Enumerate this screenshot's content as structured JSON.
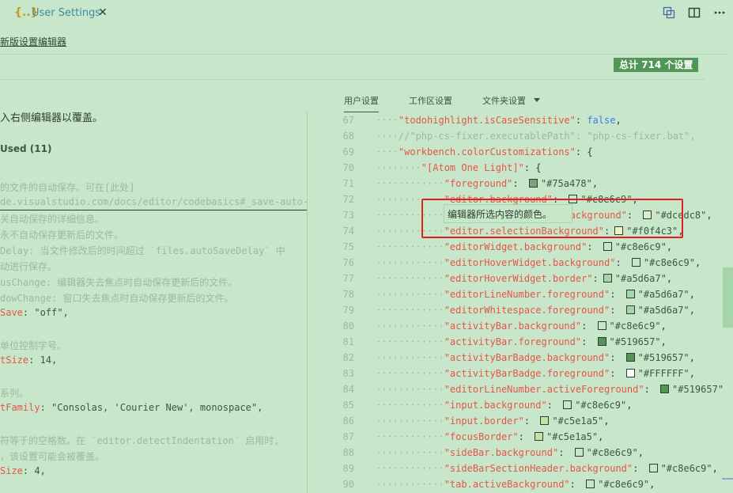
{
  "tab": {
    "title": "User Settings",
    "close": "✕",
    "braces": "{..}"
  },
  "link": "新版设置编辑器",
  "count_badge": "总计 714 个设置",
  "left_lines": [
    {
      "text": "入右侧编辑器以覆盖。",
      "kind": "txt"
    },
    {
      "text": "Used (11)",
      "kind": "hdr"
    },
    {
      "text": "的文件的自动保存。可在[此处]",
      "kind": "cmt"
    },
    {
      "text": "de.visualstudio.com/docs/editor/codebasics#_save-auto-s",
      "kind": "cmt"
    },
    {
      "text": "关自动保存的详细信息。",
      "kind": "cmt"
    },
    {
      "text": "永不自动保存更新后的文件。",
      "kind": "cmt"
    },
    {
      "text": "Delay: 当文件修改后的时间超过 `files.autoSaveDelay` 中",
      "kind": "cmt"
    },
    {
      "text": "动进行保存。",
      "kind": "cmt"
    },
    {
      "text": "usChange: 编辑器失去焦点时自动保存更新后的文件。",
      "kind": "cmt"
    },
    {
      "text": "dowChange: 窗口失去焦点时自动保存更新后的文件。",
      "kind": "cmt"
    },
    {
      "key": "Save",
      "rest": ": \"off\","
    },
    {
      "text": "单位控制字号。",
      "kind": "cmt"
    },
    {
      "key": "tSize",
      "rest": ": 14,"
    },
    {
      "text": "系列。",
      "kind": "cmt"
    },
    {
      "key": "tFamily",
      "rest": ": \"Consolas, 'Courier New', monospace\","
    },
    {
      "text": "符等于的空格数。在 `editor.detectIndentation` 启用时,",
      "kind": "cmt"
    },
    {
      "text": "，该设置可能会被覆盖。",
      "kind": "cmt"
    },
    {
      "key": "Size",
      "rest": ": 4,"
    }
  ],
  "scope_tabs": [
    "用户设置",
    "工作区设置",
    "文件夹设置"
  ],
  "code": [
    {
      "n": "67",
      "indent": 1,
      "key": "\"todohighlight.isCaseSensitive\"",
      "rest": ": ",
      "val": "false",
      "valtype": "b",
      "tail": ","
    },
    {
      "n": "68",
      "indent": 1,
      "comment": "//\"php-cs-fixer.executablePath\": \"php-cs-fixer.bat\","
    },
    {
      "n": "69",
      "indent": 1,
      "key": "\"workbench.colorCustomizations\"",
      "rest": ": {"
    },
    {
      "n": "70",
      "indent": 2,
      "key": "\"[Atom One Light]\"",
      "rest": ": {"
    },
    {
      "n": "71",
      "indent": 3,
      "key": "\"foreground\"",
      "rest": ": ",
      "swatch": "#75a478",
      "val": "\"#75a478\"",
      "tail": ","
    },
    {
      "n": "72",
      "indent": 3,
      "key": "\"editor.background\"",
      "rest": ": ",
      "swatch": "#c8e6c9",
      "val": "\"#c8e6c9\"",
      "tail": ","
    },
    {
      "n": "73",
      "indent": 3,
      "key": "\"editor.lineHighlightBackground\"",
      "rest": ": ",
      "swatch": "#dcedc8",
      "val": "\"#dcedc8\"",
      "tail": ","
    },
    {
      "n": "74",
      "indent": 3,
      "key": "\"editor.selectionBackground\"",
      "rest": ":",
      "swatch": "#f0f4c3",
      "val": "\"#f0f4c3\"",
      "tail": ","
    },
    {
      "n": "75",
      "indent": 3,
      "key": "\"editorWidget.background\"",
      "rest": ": ",
      "swatch": "#c8e6c9",
      "val": "\"#c8e6c9\"",
      "tail": ","
    },
    {
      "n": "76",
      "indent": 3,
      "key": "\"editorHoverWidget.background\"",
      "rest": ": ",
      "swatch": "#c8e6c9",
      "val": "\"#c8e6c9\"",
      "tail": ","
    },
    {
      "n": "77",
      "indent": 3,
      "key": "\"editorHoverWidget.border\"",
      "rest": ":",
      "swatch": "#a5d6a7",
      "val": "\"#a5d6a7\"",
      "tail": ","
    },
    {
      "n": "78",
      "indent": 3,
      "key": "\"editorLineNumber.foreground\"",
      "rest": ": ",
      "swatch": "#a5d6a7",
      "val": "\"#a5d6a7\"",
      "tail": ","
    },
    {
      "n": "79",
      "indent": 3,
      "key": "\"editorWhitespace.foreground\"",
      "rest": ": ",
      "swatch": "#a5d6a7",
      "val": "\"#a5d6a7\"",
      "tail": ","
    },
    {
      "n": "80",
      "indent": 3,
      "key": "\"activityBar.background\"",
      "rest": ": ",
      "swatch": "#c8e6c9",
      "val": "\"#c8e6c9\"",
      "tail": ","
    },
    {
      "n": "81",
      "indent": 3,
      "key": "\"activityBar.foreground\"",
      "rest": ": ",
      "swatch": "#519657",
      "val": "\"#519657\"",
      "tail": ","
    },
    {
      "n": "82",
      "indent": 3,
      "key": "\"activityBarBadge.background\"",
      "rest": ": ",
      "swatch": "#519657",
      "val": "\"#519657\"",
      "tail": ","
    },
    {
      "n": "83",
      "indent": 3,
      "key": "\"activityBarBadge.foreground\"",
      "rest": ": ",
      "swatch": "#FFFFFF",
      "val": "\"#FFFFFF\"",
      "tail": ","
    },
    {
      "n": "84",
      "indent": 3,
      "key": "\"editorLineNumber.activeForeground\"",
      "rest": ": ",
      "swatch": "#519657",
      "val": "\"#519657\"",
      "tail": ","
    },
    {
      "n": "85",
      "indent": 3,
      "key": "\"input.background\"",
      "rest": ": ",
      "swatch": "#c8e6c9",
      "val": "\"#c8e6c9\"",
      "tail": ","
    },
    {
      "n": "86",
      "indent": 3,
      "key": "\"input.border\"",
      "rest": ": ",
      "swatch": "#c5e1a5",
      "val": "\"#c5e1a5\"",
      "tail": ","
    },
    {
      "n": "87",
      "indent": 3,
      "key": "\"focusBorder\"",
      "rest": ": ",
      "swatch": "#c5e1a5",
      "val": "\"#c5e1a5\"",
      "tail": ","
    },
    {
      "n": "88",
      "indent": 3,
      "key": "\"sideBar.background\"",
      "rest": ": ",
      "swatch": "#c8e6c9",
      "val": "\"#c8e6c9\"",
      "tail": ","
    },
    {
      "n": "89",
      "indent": 3,
      "key": "\"sideBarSectionHeader.background\"",
      "rest": ": ",
      "swatch": "#c8e6c9",
      "val": "\"#c8e6c9\"",
      "tail": ","
    },
    {
      "n": "90",
      "indent": 3,
      "key": "\"tab.activeBackground\"",
      "rest": ": ",
      "swatch": "#c8e6c9",
      "val": "\"#c8e6c9\"",
      "tail": ","
    }
  ],
  "tooltip": "编辑器所选内容的颜色。",
  "colors": {
    "background": "#c8e6c9",
    "accent": "#519657",
    "highlight_box": "#e02020"
  }
}
